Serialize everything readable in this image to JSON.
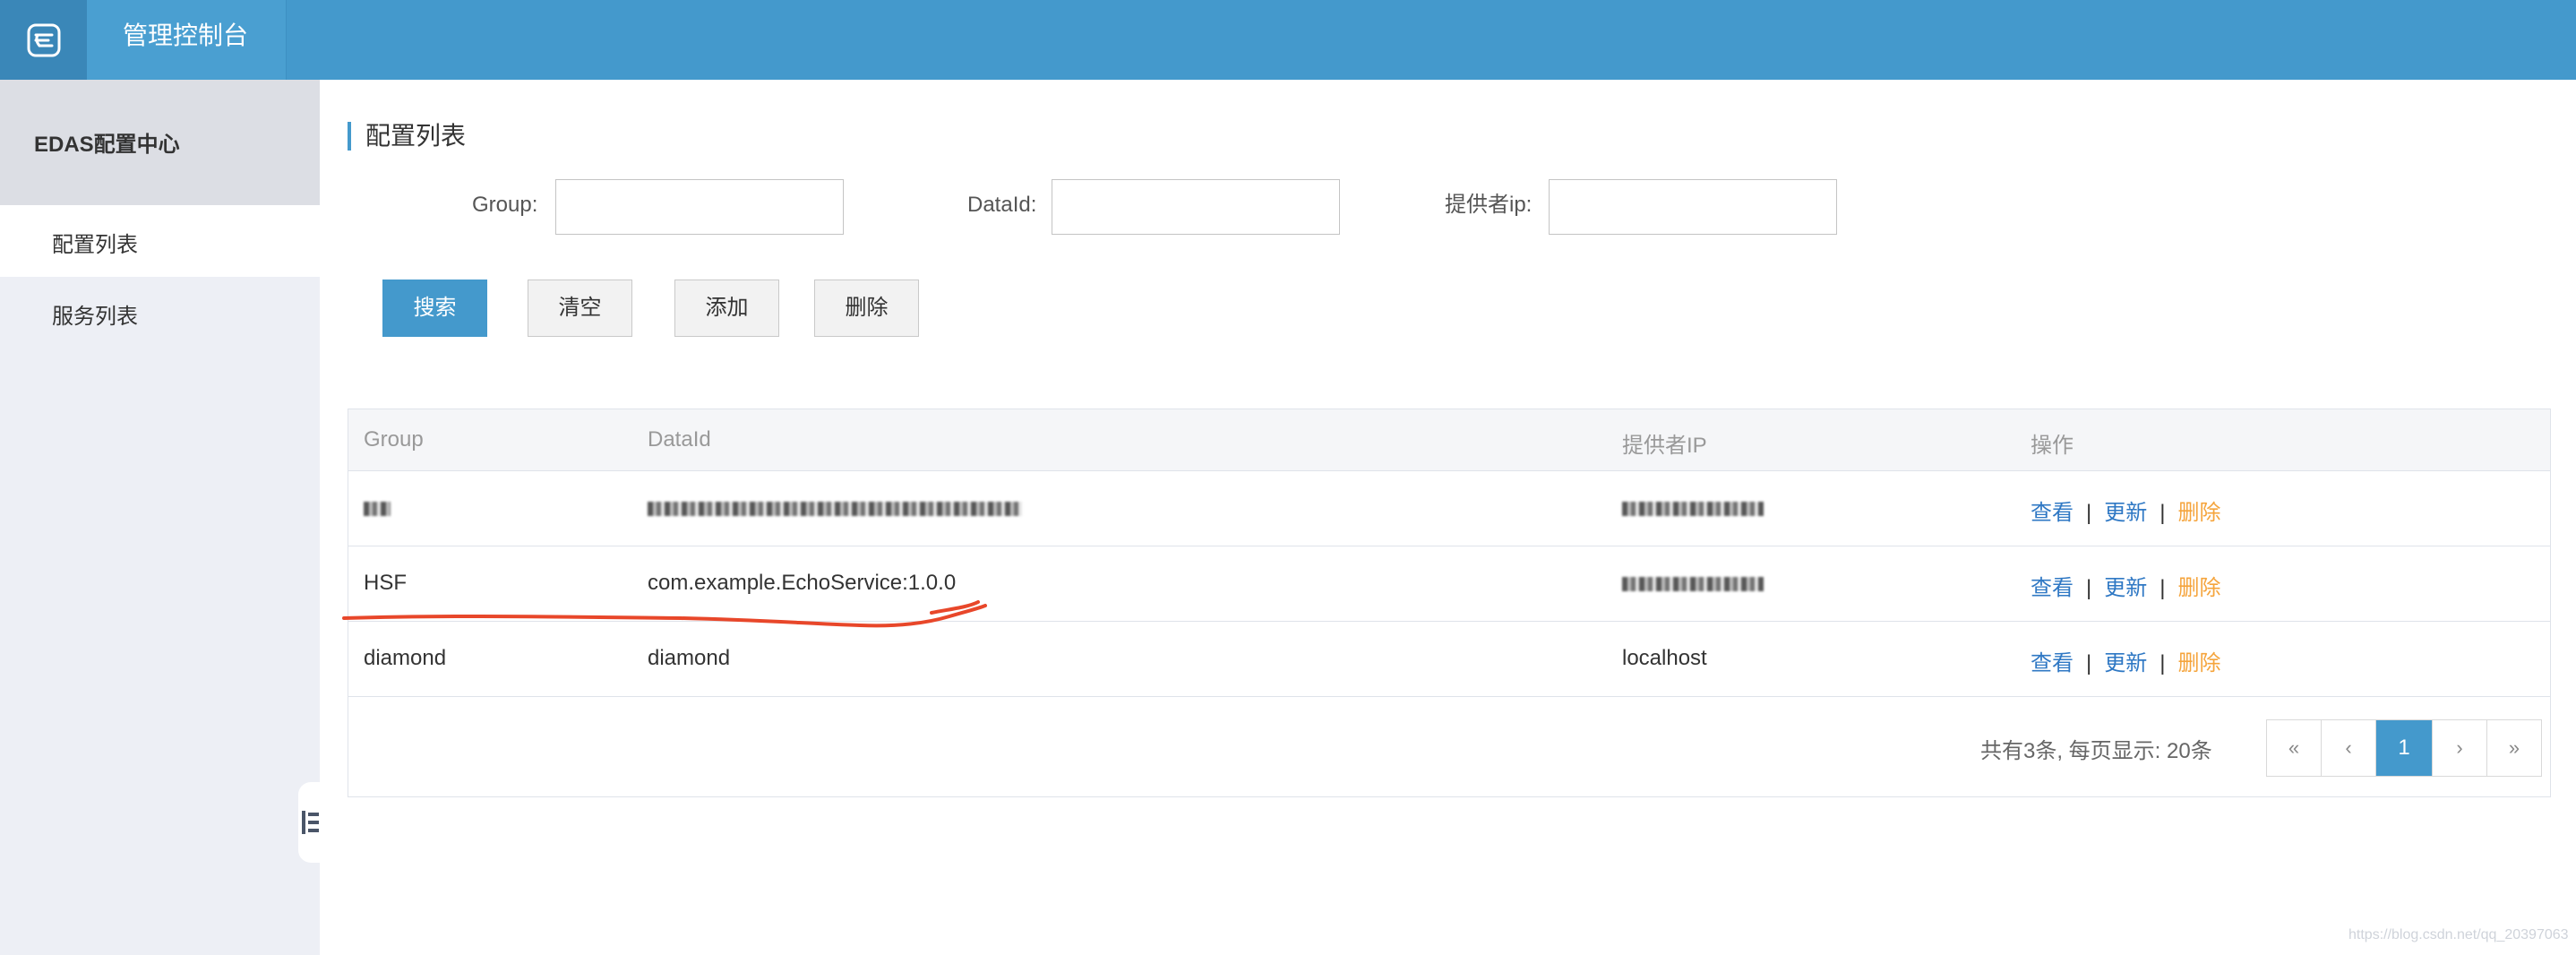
{
  "header": {
    "title": "管理控制台",
    "logo_icon": "cloud-logo-icon"
  },
  "sidebar": {
    "title": "EDAS配置中心",
    "items": [
      {
        "label": "配置列表",
        "active": true
      },
      {
        "label": "服务列表",
        "active": false
      }
    ],
    "collapse_icon": "collapse-icon"
  },
  "main": {
    "section_title": "配置列表",
    "filters": {
      "group_label": "Group:",
      "group_value": "",
      "dataid_label": "DataId:",
      "dataid_value": "",
      "provider_label": "提供者ip:",
      "provider_value": ""
    },
    "buttons": {
      "search": "搜索",
      "clear": "清空",
      "add": "添加",
      "delete": "删除"
    },
    "table": {
      "columns": [
        "Group",
        "DataId",
        "提供者IP",
        "操作"
      ],
      "rows": [
        {
          "group": "",
          "dataid": "",
          "ip": "",
          "redacted": true
        },
        {
          "group": "HSF",
          "dataid": "com.example.EchoService:1.0.0",
          "ip": "",
          "ip_redacted": true
        },
        {
          "group": "diamond",
          "dataid": "diamond",
          "ip": "localhost"
        }
      ],
      "actions": {
        "view": "查看",
        "update": "更新",
        "delete": "删除",
        "separator": "|"
      }
    },
    "pagination": {
      "info": "共有3条, 每页显示: 20条",
      "first": "«",
      "prev": "‹",
      "current": "1",
      "next": "›",
      "last": "»"
    }
  },
  "colors": {
    "topbar": "#4499cc",
    "primary_button": "#4499cc",
    "link": "#2f78c4",
    "delete_link": "#f5a43c",
    "annotation": "#e8472a"
  },
  "watermark": "https://blog.csdn.net/qq_20397063"
}
